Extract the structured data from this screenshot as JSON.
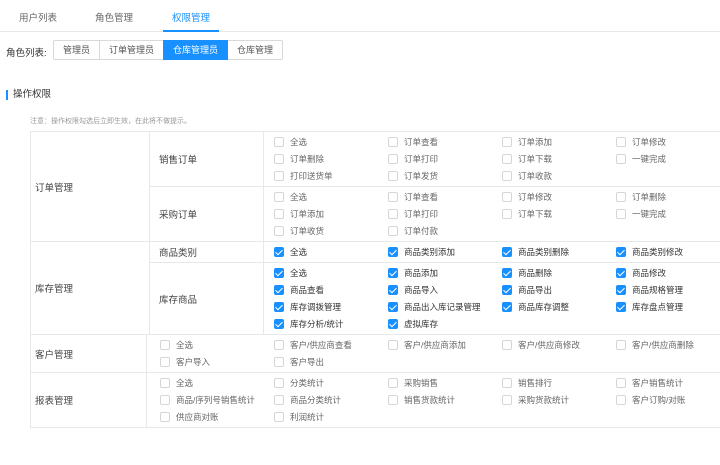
{
  "tabs": [
    {
      "label": "用户列表",
      "active": false
    },
    {
      "label": "角色管理",
      "active": false
    },
    {
      "label": "权限管理",
      "active": true
    }
  ],
  "roles": {
    "label": "角色列表:",
    "items": [
      {
        "label": "管理员",
        "active": false
      },
      {
        "label": "订单管理员",
        "active": false
      },
      {
        "label": "仓库管理员",
        "active": true
      },
      {
        "label": "仓库管理",
        "active": false
      }
    ]
  },
  "section": {
    "title": "操作权限",
    "notice": "注意：操作权限勾选后立即生效，在此将不做提示。"
  },
  "colors": {
    "accent": "#1890ff",
    "border": "#e8e8e8"
  },
  "groups": [
    {
      "label": "订单管理",
      "subs": [
        {
          "label": "销售订单",
          "items": [
            {
              "label": "全选",
              "checked": false
            },
            {
              "label": "订单查看",
              "checked": false
            },
            {
              "label": "订单添加",
              "checked": false
            },
            {
              "label": "订单修改",
              "checked": false
            },
            {
              "label": "订单删除",
              "checked": false
            },
            {
              "label": "订单打印",
              "checked": false
            },
            {
              "label": "订单下载",
              "checked": false
            },
            {
              "label": "一键完成",
              "checked": false
            },
            {
              "label": "打印送货单",
              "checked": false
            },
            {
              "label": "订单发货",
              "checked": false
            },
            {
              "label": "订单收款",
              "checked": false
            }
          ]
        },
        {
          "label": "采购订单",
          "items": [
            {
              "label": "全选",
              "checked": false
            },
            {
              "label": "订单查看",
              "checked": false
            },
            {
              "label": "订单修改",
              "checked": false
            },
            {
              "label": "订单删除",
              "checked": false
            },
            {
              "label": "订单添加",
              "checked": false
            },
            {
              "label": "订单打印",
              "checked": false
            },
            {
              "label": "订单下载",
              "checked": false
            },
            {
              "label": "一键完成",
              "checked": false
            },
            {
              "label": "订单收货",
              "checked": false
            },
            {
              "label": "订单付款",
              "checked": false
            }
          ]
        }
      ]
    },
    {
      "label": "库存管理",
      "subs": [
        {
          "label": "商品类别",
          "items": [
            {
              "label": "全选",
              "checked": true
            },
            {
              "label": "商品类别添加",
              "checked": true
            },
            {
              "label": "商品类别删除",
              "checked": true
            },
            {
              "label": "商品类别修改",
              "checked": true
            }
          ]
        },
        {
          "label": "库存商品",
          "items": [
            {
              "label": "全选",
              "checked": true
            },
            {
              "label": "商品添加",
              "checked": true
            },
            {
              "label": "商品删除",
              "checked": true
            },
            {
              "label": "商品修改",
              "checked": true
            },
            {
              "label": "商品查看",
              "checked": true
            },
            {
              "label": "商品导入",
              "checked": true
            },
            {
              "label": "商品导出",
              "checked": true
            },
            {
              "label": "商品规格管理",
              "checked": true
            },
            {
              "label": "库存调拨管理",
              "checked": true
            },
            {
              "label": "商品出入库记录管理",
              "checked": true
            },
            {
              "label": "商品库存调整",
              "checked": true
            },
            {
              "label": "库存盘点管理",
              "checked": true
            },
            {
              "label": "库存分析/统计",
              "checked": true
            },
            {
              "label": "虚拟库存",
              "checked": true
            }
          ]
        }
      ]
    },
    {
      "label": "客户管理",
      "items": [
        {
          "label": "全选",
          "checked": false
        },
        {
          "label": "客户/供应商查看",
          "checked": false
        },
        {
          "label": "客户/供应商添加",
          "checked": false
        },
        {
          "label": "客户/供应商修改",
          "checked": false
        },
        {
          "label": "客户/供应商删除",
          "checked": false
        },
        {
          "label": "客户导入",
          "checked": false
        },
        {
          "label": "客户导出",
          "checked": false
        }
      ]
    },
    {
      "label": "报表管理",
      "items": [
        {
          "label": "全选",
          "checked": false
        },
        {
          "label": "分类统计",
          "checked": false
        },
        {
          "label": "采购销售",
          "checked": false
        },
        {
          "label": "销售排行",
          "checked": false
        },
        {
          "label": "客户销售统计",
          "checked": false
        },
        {
          "label": "商品/序列号销售统计",
          "checked": false
        },
        {
          "label": "商品分类统计",
          "checked": false
        },
        {
          "label": "销售货款统计",
          "checked": false
        },
        {
          "label": "采购货款统计",
          "checked": false
        },
        {
          "label": "客户订购/对账",
          "checked": false
        },
        {
          "label": "供应商对账",
          "checked": false
        },
        {
          "label": "利润统计",
          "checked": false
        }
      ]
    }
  ]
}
